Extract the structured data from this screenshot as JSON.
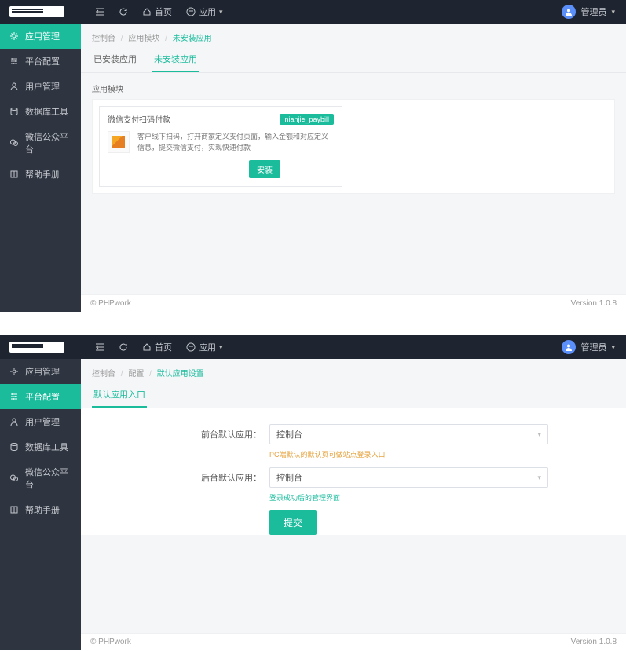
{
  "top": {
    "home": "首页",
    "apps": "应用",
    "user": "管理员"
  },
  "side": {
    "items": [
      {
        "label": "应用管理"
      },
      {
        "label": "平台配置"
      },
      {
        "label": "用户管理"
      },
      {
        "label": "数据库工具"
      },
      {
        "label": "微信公众平台"
      },
      {
        "label": "帮助手册"
      }
    ]
  },
  "panel1": {
    "crumbs": {
      "a": "控制台",
      "b": "应用模块",
      "c": "未安装应用"
    },
    "tabs": {
      "installed": "已安装应用",
      "not_installed": "未安装应用"
    },
    "section": "应用模块",
    "module": {
      "title": "微信支付扫码付款",
      "badge": "nianjie_paybill",
      "desc": "客户线下扫码，打开商家定义支付页面，输入金额和对应定义信息，提交微信支付，实现快速付款",
      "install": "安装"
    }
  },
  "panel2": {
    "crumbs": {
      "a": "控制台",
      "b": "配置",
      "c": "默认应用设置"
    },
    "tab": "默认应用入口",
    "form": {
      "front_label": "前台默认应用：",
      "back_label": "后台默认应用：",
      "select_value": "控制台",
      "help_front": "PC端默认的默认页可做站点登录入口",
      "help_back": "登录成功后的管理界面",
      "submit": "提交"
    }
  },
  "footer": {
    "copyright": "© PHPwork",
    "version": "Version 1.0.8"
  }
}
